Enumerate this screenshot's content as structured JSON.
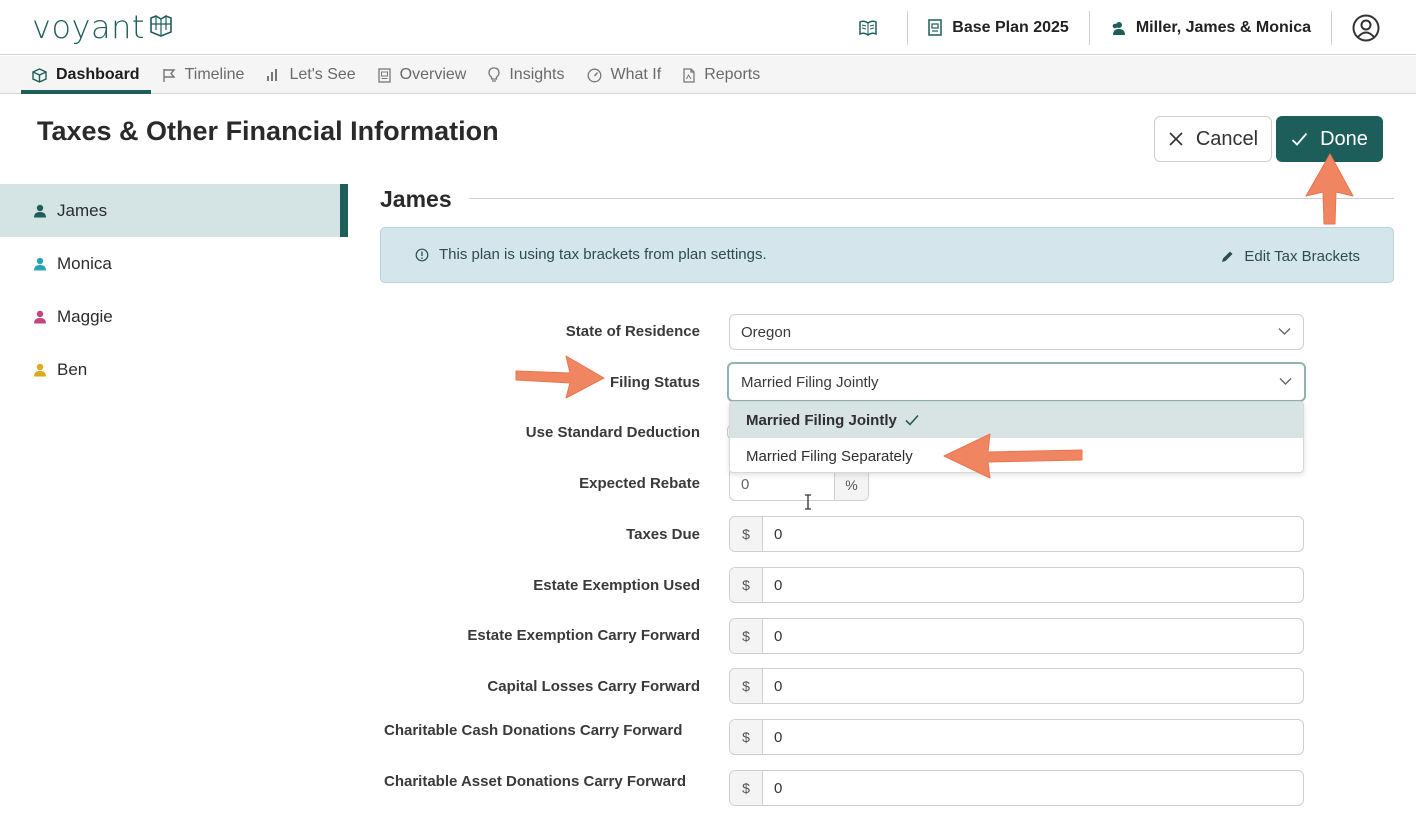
{
  "brand": {
    "name": "voyant"
  },
  "header": {
    "plan_name": "Base Plan 2025",
    "client_name": "Miller, James & Monica"
  },
  "nav": {
    "tabs": [
      {
        "label": "Dashboard",
        "icon": "box-icon",
        "active": true
      },
      {
        "label": "Timeline",
        "icon": "flag-icon"
      },
      {
        "label": "Let's See",
        "icon": "bar-chart-icon"
      },
      {
        "label": "Overview",
        "icon": "document-icon"
      },
      {
        "label": "Insights",
        "icon": "lightbulb-icon"
      },
      {
        "label": "What If",
        "icon": "gauge-icon"
      },
      {
        "label": "Reports",
        "icon": "report-icon"
      }
    ]
  },
  "page": {
    "title": "Taxes & Other Financial Information",
    "cancel_label": "Cancel",
    "done_label": "Done"
  },
  "people": [
    {
      "name": "James",
      "color": "#1e5e5a",
      "active": true
    },
    {
      "name": "Monica",
      "color": "#2aa3b5"
    },
    {
      "name": "Maggie",
      "color": "#c4457a"
    },
    {
      "name": "Ben",
      "color": "#e0a81c"
    }
  ],
  "section": {
    "title": "James",
    "info_text": "This plan is using tax brackets from plan settings.",
    "edit_link": "Edit Tax Brackets"
  },
  "form": {
    "state_label": "State of Residence",
    "state_value": "Oregon",
    "filing_label": "Filing Status",
    "filing_value": "Married Filing Jointly",
    "filing_options": [
      "Married Filing Jointly",
      "Married Filing Separately"
    ],
    "deduction_label": "Use Standard Deduction",
    "rebate_label": "Expected Rebate",
    "rebate_value": "0",
    "rebate_suffix": "%",
    "currency_prefix": "$",
    "money_fields": [
      {
        "label": "Taxes Due",
        "value": "0"
      },
      {
        "label": "Estate Exemption Used",
        "value": "0"
      },
      {
        "label": "Estate Exemption Carry Forward",
        "value": "0"
      },
      {
        "label": "Capital Losses Carry Forward",
        "value": "0"
      },
      {
        "label": "Charitable Cash Donations Carry Forward",
        "value": "0"
      },
      {
        "label": "Charitable Asset Donations Carry Forward",
        "value": "0"
      }
    ]
  },
  "colors": {
    "brand": "#1e5e5a",
    "annotation_arrow": "#f08562",
    "banner_bg": "#d4e6ec"
  }
}
